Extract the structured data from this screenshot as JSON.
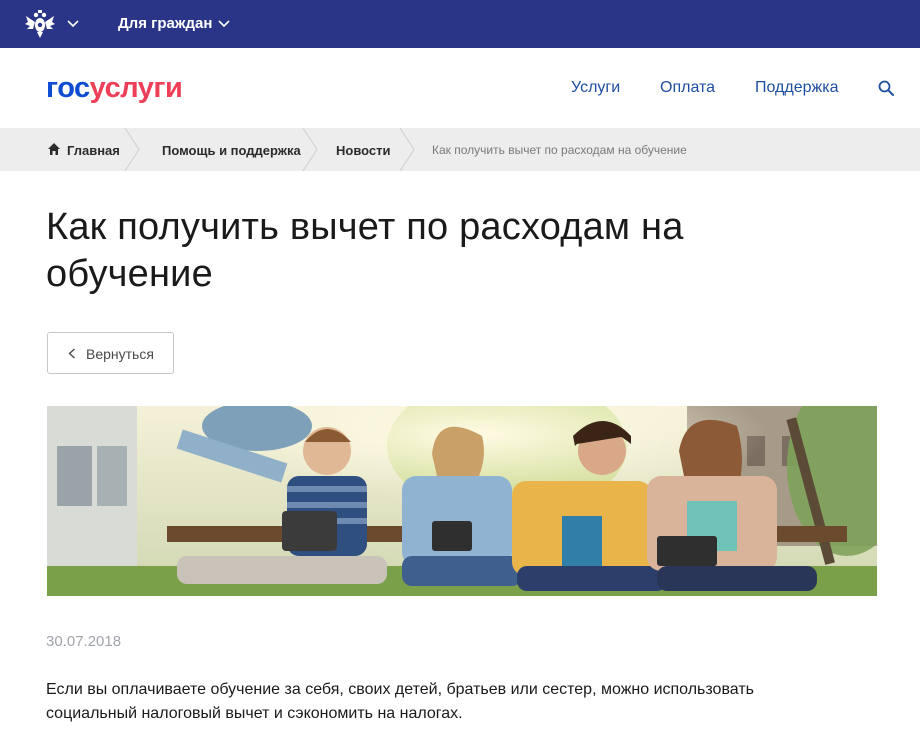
{
  "topbar": {
    "audience_label": "Для граждан",
    "icons": [
      "emblem-icon",
      "chevron-down-icon"
    ],
    "background": "#2a3587"
  },
  "header": {
    "logo_part1": "гос",
    "logo_part2": "услуги",
    "nav": {
      "services": "Услуги",
      "payment": "Оплата",
      "support": "Поддержка"
    },
    "search_icon": "search-icon",
    "brand_blue": "#0d4cd3",
    "brand_red": "#ee3f58"
  },
  "breadcrumbs": {
    "home": "Главная",
    "help": "Помощь и поддержка",
    "news": "Новости",
    "current": "Как получить вычет по расходам на обучение"
  },
  "article": {
    "title": "Как получить вычет по расходам на обучение",
    "back_label": "Вернуться",
    "date": "30.07.2018",
    "lead": "Если вы оплачиваете обучение за себя, своих детей, братьев или сестер, можно использовать социальный налоговый вычет и сэкономить на налогах."
  }
}
